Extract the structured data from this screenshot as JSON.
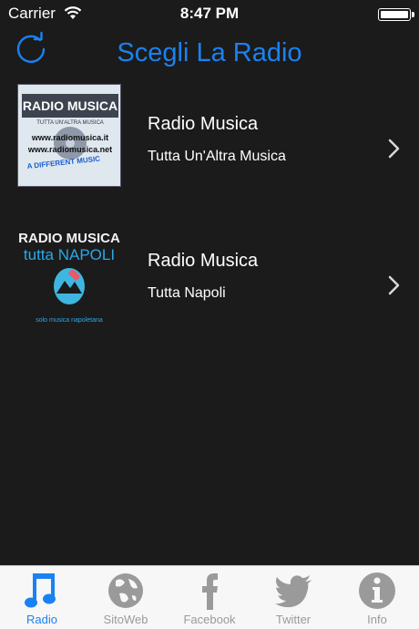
{
  "status_bar": {
    "carrier": "Carrier",
    "time": "8:47 PM"
  },
  "nav": {
    "title": "Scegli La Radio",
    "refresh_icon": "refresh-icon"
  },
  "stations": [
    {
      "title": "Radio Musica",
      "subtitle": "Tutta Un'Altra Musica",
      "logo": {
        "line1": "RADIO MUSICA",
        "line2": "TUTTA UN'ALTRA MUSICA",
        "line3": "www.radiomusica.it",
        "line4": "www.radiomusica.net",
        "line5": "A DIFFERENT MUSIC"
      }
    },
    {
      "title": "Radio Musica",
      "subtitle": "Tutta Napoli",
      "logo": {
        "line1": "RADIO MUSICA",
        "line2": "tutta NAPOLI",
        "line3": "solo musica napoletana"
      }
    }
  ],
  "tabs": [
    {
      "label": "Radio",
      "icon": "music-note-icon",
      "active": true
    },
    {
      "label": "SitoWeb",
      "icon": "globe-icon"
    },
    {
      "label": "Facebook",
      "icon": "facebook-icon"
    },
    {
      "label": "Twitter",
      "icon": "twitter-icon"
    },
    {
      "label": "Info",
      "icon": "info-icon"
    }
  ],
  "colors": {
    "accent": "#1a82f0",
    "background": "#1b1b1b",
    "tab_bar": "#f7f7f7",
    "tab_inactive": "#9a9a9a"
  }
}
